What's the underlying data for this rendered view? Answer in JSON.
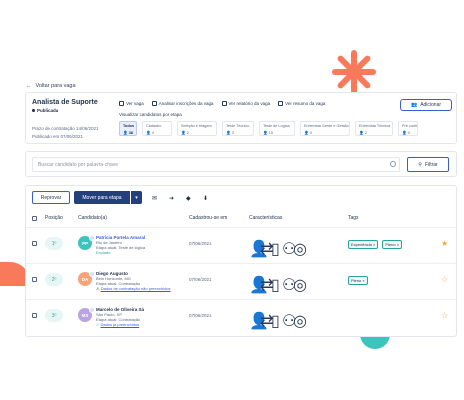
{
  "back_link": "Voltar para vaga",
  "job": {
    "title": "Analista de Suporte",
    "status": "Publicada",
    "deadline": "Prazo de contratação 14/06/2021",
    "published": "Publicado em 07/06/2021",
    "actions": [
      "Ver vaga",
      "Analisar inscrições da vaga",
      "Ver relatório da vaga",
      "Ver resumo da vaga"
    ],
    "add_label": "Adicionar",
    "stage_label": "Visualizar candidatos por etapa",
    "stages": [
      {
        "label": "Todos",
        "count": "38"
      },
      {
        "label": "Cadastro",
        "count": "4"
      },
      {
        "label": "Seleção e triagem",
        "count": "2"
      },
      {
        "label": "Teste Técnico",
        "count": "3"
      },
      {
        "label": "Teste de Lógica",
        "count": "15"
      },
      {
        "label": "Entrevista Gente e Gestão",
        "count": "0"
      },
      {
        "label": "Entrevista Técnica",
        "count": "2"
      },
      {
        "label": "Pré contr",
        "count": "0"
      }
    ]
  },
  "search": {
    "placeholder": "Buscar candidato por palavra-chave",
    "filter_label": "Filtrar"
  },
  "toolbar": {
    "reject_label": "Reprovar",
    "move_label": "Mover para etapa"
  },
  "table": {
    "headers": [
      "Posição",
      "Candidato(a)",
      "Cadastrou-se em",
      "Características",
      "Tags"
    ],
    "rows": [
      {
        "position": "1º",
        "initials": "PP",
        "avatar_color": "#3ec3bd",
        "name": "Patricia Portela Amaral",
        "location": "Rio de Janeiro",
        "stage": "Etapa atual: Teste de lógica",
        "note": "Enviado",
        "note_type": "ok",
        "date": "07/06/2021",
        "tags": [
          "Experiência",
          "Pleno"
        ],
        "star": "★"
      },
      {
        "position": "2º",
        "initials": "DA",
        "avatar_color": "#f5a37a",
        "name": "Diego Augusto",
        "location": "Belo Horizonte, MG",
        "stage": "Etapa atual: Contratação",
        "note": "Dados de contratação não preenchidos",
        "note_type": "warn",
        "date": "07/06/2021",
        "tags": [
          "Pleno"
        ],
        "star": "☆"
      },
      {
        "position": "3º",
        "initials": "MS",
        "avatar_color": "#b9a3e3",
        "name": "Marcelo de Oliveira Sá",
        "location": "São Paulo, SP",
        "stage": "Etapa atual: Contratação",
        "note": "Dados já preenchidos",
        "note_type": "ok",
        "date": "07/06/2021",
        "tags": [],
        "star": "☆"
      }
    ]
  },
  "colors": {
    "primary": "#24407a",
    "accent_teal": "#3ec3bd",
    "accent_coral": "#f97a5a",
    "star": "#f2a93b"
  }
}
